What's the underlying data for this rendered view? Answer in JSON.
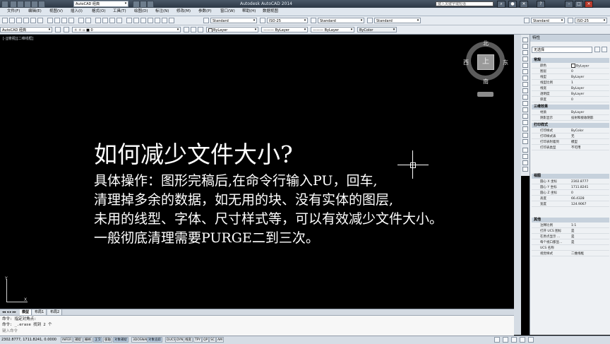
{
  "titlebar": {
    "window_title": "AutoCAD 经典",
    "doc_title": "Autodesk AutoCAD 2014",
    "search_placeholder": "键入关键字或短语"
  },
  "menu": [
    "文件(F)",
    "编辑(E)",
    "视图(V)",
    "插入(I)",
    "格式(O)",
    "工具(T)",
    "绘图(D)",
    "标注(N)",
    "修改(M)",
    "参数(P)",
    "窗口(W)",
    "帮助(H)",
    "数据视图"
  ],
  "toolbar1": {
    "workspace": "AutoCAD 经典",
    "text_style": "Standard",
    "dim_style": "ISO-25",
    "table_style": "Standard",
    "mleader_style": "Standard"
  },
  "toolbar2": {
    "layer": "0",
    "color": "ByLayer",
    "linetype": "ByLayer",
    "lineweight": "ByLayer",
    "plotstyle": "ByColor"
  },
  "canvas": {
    "viewport_label": "[-][俯视][二维线框]",
    "title": "如何减少文件大小?",
    "lines": [
      "具体操作：图形完稿后,在命令行输入PU，回车,",
      "清理掉多余的数据，如无用的块、没有实体的图层,",
      "未用的线型、字体、尺寸样式等，可以有效减少文件大小。",
      "一般彻底清理需要PURGE二到三次。"
    ],
    "viewcube": {
      "n": "北",
      "s": "南",
      "e": "东",
      "w": "西",
      "face": "上",
      "wcs": "WCS"
    },
    "ucs": {
      "x": "X",
      "y": "Y"
    }
  },
  "layout_tabs": [
    "模型",
    "布局1",
    "布局2"
  ],
  "command": {
    "lines": [
      "命令: 指定对角点:",
      "命令: _.erase 找到 2 个"
    ],
    "prompt": "键入命令"
  },
  "status": {
    "coords": "2302.8777, 1711.8241, 0.0000",
    "buttons": [
      "INFER",
      "捕捉",
      "栅格",
      "正交",
      "极轴",
      "对象捕捉",
      "3DOSNAP",
      "对象追踪",
      "DUCS",
      "DYN",
      "线宽",
      "TPY",
      "QP",
      "SC",
      "AM"
    ],
    "on_buttons": [
      "正交",
      "对象捕捉",
      "对象追踪"
    ]
  },
  "properties": {
    "panel_title": "特性",
    "selection": "无选择",
    "sections": [
      {
        "title": "常规",
        "rows": [
          {
            "k": "颜色",
            "v": "ByLayer"
          },
          {
            "k": "图层",
            "v": "0"
          },
          {
            "k": "线型",
            "v": "ByLayer"
          },
          {
            "k": "线型比例",
            "v": "1"
          },
          {
            "k": "线宽",
            "v": "ByLayer"
          },
          {
            "k": "透明度",
            "v": "ByLayer"
          },
          {
            "k": "厚度",
            "v": "0"
          }
        ]
      },
      {
        "title": "三维效果",
        "rows": [
          {
            "k": "材质",
            "v": "ByLayer"
          },
          {
            "k": "阴影显示",
            "v": "投射和接收阴影"
          }
        ]
      },
      {
        "title": "打印样式",
        "rows": [
          {
            "k": "打印样式",
            "v": "ByColor"
          },
          {
            "k": "打印样式表",
            "v": "无"
          },
          {
            "k": "打印表附着到",
            "v": "模型"
          },
          {
            "k": "打印表类型",
            "v": "不可用"
          }
        ]
      },
      {
        "title": "视图",
        "rows": [
          {
            "k": "圆心 X 坐标",
            "v": "2302.8777"
          },
          {
            "k": "圆心 Y 坐标",
            "v": "1711.8241"
          },
          {
            "k": "圆心 Z 坐标",
            "v": "0"
          },
          {
            "k": "高度",
            "v": "66.4328"
          },
          {
            "k": "宽度",
            "v": "124.9067"
          }
        ]
      },
      {
        "title": "其他",
        "rows": [
          {
            "k": "注释比例",
            "v": "1:1"
          },
          {
            "k": "打开 UCS 图标",
            "v": "是"
          },
          {
            "k": "在原点显示 ...",
            "v": "是"
          },
          {
            "k": "每个视口都显...",
            "v": "是"
          },
          {
            "k": "UCS 名称",
            "v": ""
          },
          {
            "k": "视觉样式",
            "v": "二维线框"
          }
        ]
      }
    ]
  },
  "colors": {
    "canvas_bg": "#000000",
    "text": "#ffffff",
    "ui_bg": "#dfe6ee"
  }
}
